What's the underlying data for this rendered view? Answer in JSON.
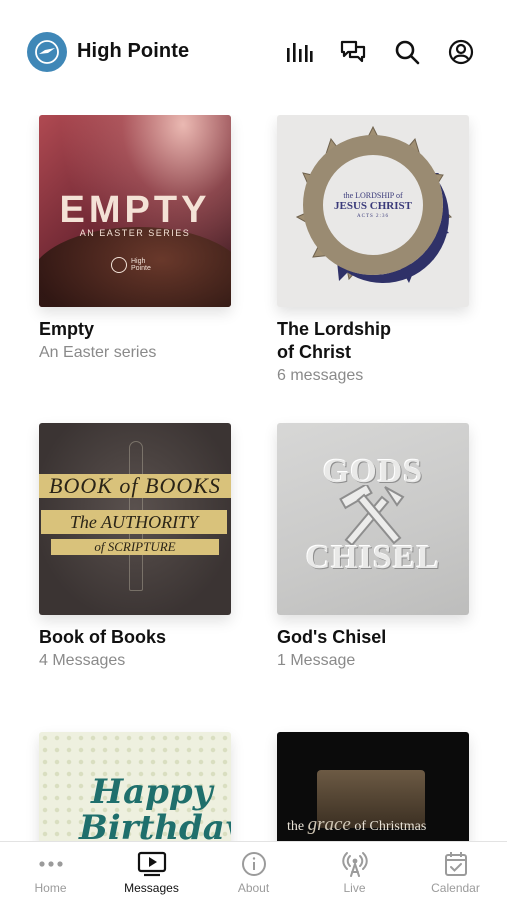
{
  "header": {
    "app_title": "High Pointe",
    "icons": [
      "logo-icon",
      "equalizer-icon",
      "chat-icon",
      "search-icon",
      "account-icon"
    ]
  },
  "series": [
    {
      "title": "Empty",
      "subtitle": "An Easter series",
      "art": {
        "big": "EMPTY",
        "small": "AN EASTER SERIES",
        "logo1": "High",
        "logo2": "Pointe"
      }
    },
    {
      "title": "The Lordship of Christ",
      "subtitle": "6 messages",
      "art": {
        "line1": "the LORDSHIP of",
        "line2": "JESUS CHRIST",
        "line3": "ACTS 2:36"
      }
    },
    {
      "title": "Book of Books",
      "subtitle": "4 Messages",
      "art": {
        "line1": "BOOK of BOOKS",
        "line2": "The AUTHORITY",
        "line3": "of SCRIPTURE"
      }
    },
    {
      "title": "God's Chisel",
      "subtitle": "1 Message",
      "art": {
        "line1": "GODS",
        "line2": "CHISEL"
      }
    },
    {
      "title": "",
      "subtitle": "",
      "art": {
        "line1": "Happy",
        "line2": "Birthday,"
      }
    },
    {
      "title": "",
      "subtitle": "",
      "art": {
        "pre": "the",
        "mid": "grace",
        "post": "of Christmas"
      }
    }
  ],
  "tabs": [
    {
      "label": "Home",
      "icon": "more-dots-icon",
      "active": false
    },
    {
      "label": "Messages",
      "icon": "play-screen-icon",
      "active": true
    },
    {
      "label": "About",
      "icon": "info-icon",
      "active": false
    },
    {
      "label": "Live",
      "icon": "broadcast-icon",
      "active": false
    },
    {
      "label": "Calendar",
      "icon": "calendar-icon",
      "active": false
    }
  ],
  "colors": {
    "brand": "#3f87b7",
    "active_tab": "#111111",
    "inactive_tab": "#9b9b9b",
    "subtitle": "#8a8a8a"
  }
}
